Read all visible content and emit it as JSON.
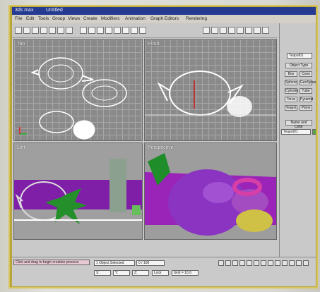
{
  "window": {
    "title": "3ds max",
    "subtitle": "Untitled"
  },
  "menus": [
    "File",
    "Edit",
    "Tools",
    "Group",
    "Views",
    "Create",
    "Modifiers",
    "Animation",
    "Graph Editors",
    "Rendering"
  ],
  "viewports": {
    "top": "Top",
    "front": "Front",
    "left": "Left",
    "perspective": "Perspective"
  },
  "command_panel": {
    "object_name": "Teapot01",
    "rollout": "Object Type",
    "buttons": [
      "Box",
      "Cone",
      "Sphere",
      "GeoSphere",
      "Cylinder",
      "Tube",
      "Torus",
      "Pyramid",
      "Teapot",
      "Plane"
    ],
    "name_section": "Name and Color",
    "name_value": "Teapot01"
  },
  "status": {
    "prompt": "Click and drag to begin creation process",
    "selection": "1 Object Selected",
    "time": "0 / 100",
    "x": "X:",
    "y": "Y:",
    "z": "Z:",
    "lock": "Lock",
    "grid": "Grid = 10.0"
  },
  "colors": {
    "title": "#243b91",
    "purple": "#7b21a5",
    "yellow_bezel": "#b8a63a",
    "green": "#1f8d2a"
  },
  "icons": [
    "select-icon",
    "move-icon",
    "rotate-icon",
    "scale-icon",
    "render-icon",
    "play-icon",
    "stop-icon"
  ]
}
